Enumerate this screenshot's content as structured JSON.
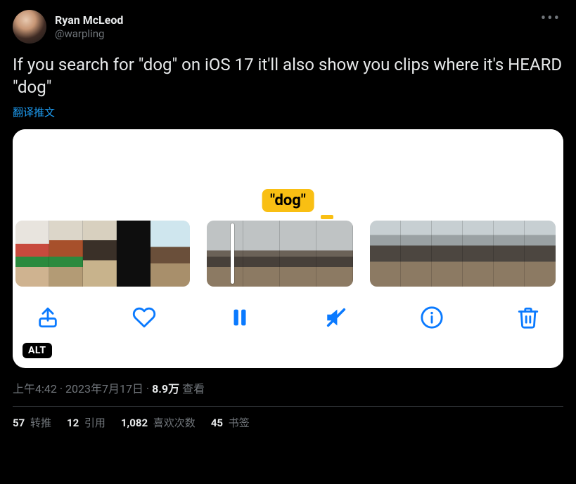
{
  "author": {
    "display_name": "Ryan McLeod",
    "handle": "@warpling"
  },
  "body": "If you search for \"dog\" on iOS 17 it'll also show you clips where it's HEARD \"dog\"",
  "translate_label": "翻译推文",
  "media": {
    "search_label": "\"dog\"",
    "alt_badge": "ALT",
    "toolbar": {
      "share": "share",
      "like": "like",
      "pause": "pause",
      "mute": "mute",
      "info": "info",
      "trash": "trash"
    }
  },
  "meta": {
    "time": "上午4:42",
    "date": "2023年7月17日",
    "views_number": "8.9万",
    "views_label": "查看"
  },
  "stats": {
    "retweets": {
      "num": "57",
      "label": "转推"
    },
    "quotes": {
      "num": "12",
      "label": "引用"
    },
    "likes": {
      "num": "1,082",
      "label": "喜欢次数"
    },
    "bookmarks": {
      "num": "45",
      "label": "书签"
    }
  }
}
